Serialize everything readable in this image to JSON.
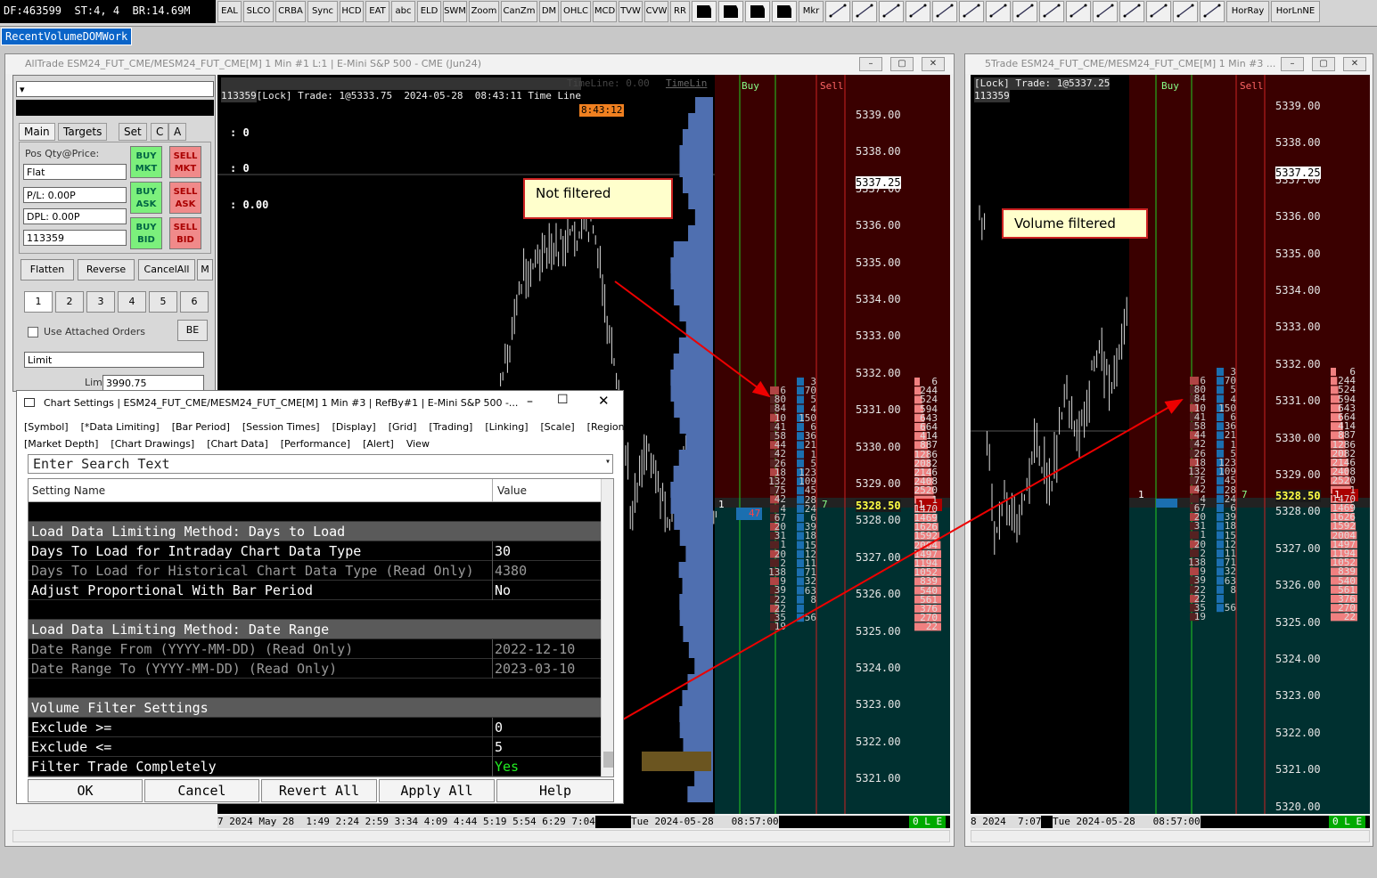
{
  "toolbar": {
    "status": "DF:463599  ST:4, 4  BR:14.69M",
    "buttons": [
      "EAL",
      "SLCO",
      "CRBA",
      "Sync",
      "HCD",
      "EAT",
      "abc",
      "ELD",
      "SWM",
      "Zoom",
      "CanZm",
      "DM",
      "OHLC",
      "MCD",
      "TVW",
      "CVW",
      "RR"
    ],
    "buttons2": [
      "Mkr"
    ],
    "buttons3": [
      "HorRay",
      "HorLnNE"
    ]
  },
  "workspace_tab": "RecentVolumeDOMWork",
  "win1": {
    "title": "AllTrade ESM24_FUT_CME/MESM24_FUT_CME[M]  1 Min  #1 L:1 | E-Mini S&P 500 - CME (Jun24)",
    "header": "[Lock] Trade: 1@5333.75  2024-05-28  08:43:11 Time Line",
    "header_dim": "TimeLine: 0.00",
    "header_tl": "TimeLin",
    "sym": "113359",
    "timebox": "8:43:12",
    "metric1": ": 0",
    "metric2": ": 0",
    "metric3": ": 0.00",
    "buy_label": "Buy",
    "sell_label": "Sell",
    "prices": [
      "5339.00",
      "5338.00",
      "5337.00",
      "5336.00",
      "5335.00",
      "5334.00",
      "5333.00",
      "5332.00",
      "5331.00",
      "5330.00",
      "5329.00",
      "5328.00",
      "5327.00",
      "5326.00",
      "5325.00",
      "5324.00",
      "5323.00",
      "5322.00",
      "5321.00"
    ],
    "cur_price": "5337.25",
    "last_price": "5328.50",
    "pos_qty": "1",
    "pos_ask": "1",
    "pos_bid": "47",
    "pos_mid": "7",
    "bid_vol": "6\n80\n84\n10\n41\n58\n44\n42\n26\n18\n132\n75\n42\n4\n67\n20\n31\n1\n20\n2\n138\n9\n39\n22\n22\n35\n19",
    "ask_vol": "3\n70\n5\n4\n150\n6\n36\n21\n1\n5\n123\n109\n45\n28\n24\n6\n39\n18\n15\n12\n11\n71\n32\n63\n8\n\n56",
    "sell_vol": "6\n244\n524\n594\n643\n664\n414\n887\n1286\n2082\n2146\n2408\n2520\n1\n1470\n1469\n1626\n1592\n2004\n1497\n1194\n1052\n839\n540\n561\n376\n270\n22",
    "time_labels": "7 2024 May 28  1:49 2:24 2:59 3:34 4:09 4:44 5:19 5:54 6:29 7:04",
    "time_cursor": "Tue 2024-05-28   08:57:00",
    "ole": "0 L E"
  },
  "win2": {
    "title": "5Trade ESM24_FUT_CME/MESM24_FUT_CME[M]  1 Min  #3 ...",
    "header": "[Lock] Trade: 1@5337.25",
    "sym": "113359",
    "buy_label": "Buy",
    "sell_label": "Sell",
    "prices": [
      "5339.00",
      "5338.00",
      "5337.00",
      "5336.00",
      "5335.00",
      "5334.00",
      "5333.00",
      "5332.00",
      "5331.00",
      "5330.00",
      "5329.00",
      "5328.00",
      "5327.00",
      "5326.00",
      "5325.00",
      "5324.00",
      "5323.00",
      "5322.00",
      "5321.00",
      "5320.00"
    ],
    "cur_price": "5337.25",
    "last_price": "5328.50",
    "pos_qty": "1",
    "pos_ask": "1",
    "pos_mid": "7",
    "time_labels": "8 2024  7:07",
    "time_cursor": "Tue 2024-05-28   08:57:00",
    "ole": "0 L E"
  },
  "callouts": {
    "not_filtered": "Not filtered",
    "volume_filtered": "Volume filtered"
  },
  "trade": {
    "tabs": [
      "Main",
      "Targets",
      "Set",
      "C",
      "A"
    ],
    "pos_label": "Pos Qty@Price:",
    "pos_value": "Flat",
    "pl": "P/L: 0.00P",
    "dpl": "DPL: 0.00P",
    "account": "113359",
    "buy_mkt": "BUY\nMKT",
    "sell_mkt": "SELL\nMKT",
    "buy_ask": "BUY\nASK",
    "sell_ask": "SELL\nASK",
    "buy_bid": "BUY\nBID",
    "sell_bid": "SELL\nBID",
    "flatten": "Flatten",
    "reverse": "Reverse",
    "cancel_all": "CancelAll",
    "m": "M",
    "qty": [
      "1",
      "2",
      "3",
      "4",
      "5",
      "6"
    ],
    "attached": "Use Attached Orders",
    "be": "BE",
    "order_type": "Limit",
    "limit_label": "Limit:",
    "limit_value": "3990.75"
  },
  "dialog": {
    "title": "Chart Settings | ESM24_FUT_CME/MESM24_FUT_CME[M]  1 Min  #3 | RefBy#1 | E-Mini S&P 500 -...",
    "menu1": [
      "[Symbol]",
      "[*Data Limiting]",
      "[Bar Period]",
      "[Session Times]",
      "[Display]",
      "[Grid]",
      "[Trading]",
      "[Linking]",
      "[Scale]",
      "[Regions]"
    ],
    "menu2": [
      "[Market Depth]",
      "[Chart Drawings]",
      "[Chart Data]",
      "[Performance]",
      "[Alert]",
      "View"
    ],
    "search": "Enter Search Text",
    "col_name": "Setting Name",
    "col_value": "Value",
    "rows": [
      {
        "name": "",
        "value": "",
        "kind": "blank"
      },
      {
        "name": "Load Data Limiting Method: Days to Load",
        "value": "",
        "kind": "hdr"
      },
      {
        "name": "Days To Load for Intraday Chart Data Type",
        "value": "30",
        "kind": "n"
      },
      {
        "name": "Days To Load for Historical Chart Data Type (Read Only)",
        "value": "4380",
        "kind": "ro"
      },
      {
        "name": "Adjust Proportional With Bar Period",
        "value": "No",
        "kind": "n"
      },
      {
        "name": "",
        "value": "",
        "kind": "blank"
      },
      {
        "name": "Load Data Limiting Method: Date Range",
        "value": "",
        "kind": "hdr"
      },
      {
        "name": "Date Range From (YYYY-MM-DD) (Read Only)",
        "value": "2022-12-10",
        "kind": "ro"
      },
      {
        "name": "Date Range To (YYYY-MM-DD) (Read Only)",
        "value": "2023-03-10",
        "kind": "ro"
      },
      {
        "name": "",
        "value": "",
        "kind": "blank"
      },
      {
        "name": "Volume Filter Settings",
        "value": "",
        "kind": "hdr"
      },
      {
        "name": "Exclude >=",
        "value": "0",
        "kind": "n"
      },
      {
        "name": "Exclude <=",
        "value": "5",
        "kind": "n"
      },
      {
        "name": "Filter Trade Completely",
        "value": "Yes",
        "kind": "yes"
      }
    ],
    "buttons": [
      "OK",
      "Cancel",
      "Revert All",
      "Apply All",
      "Help"
    ]
  }
}
